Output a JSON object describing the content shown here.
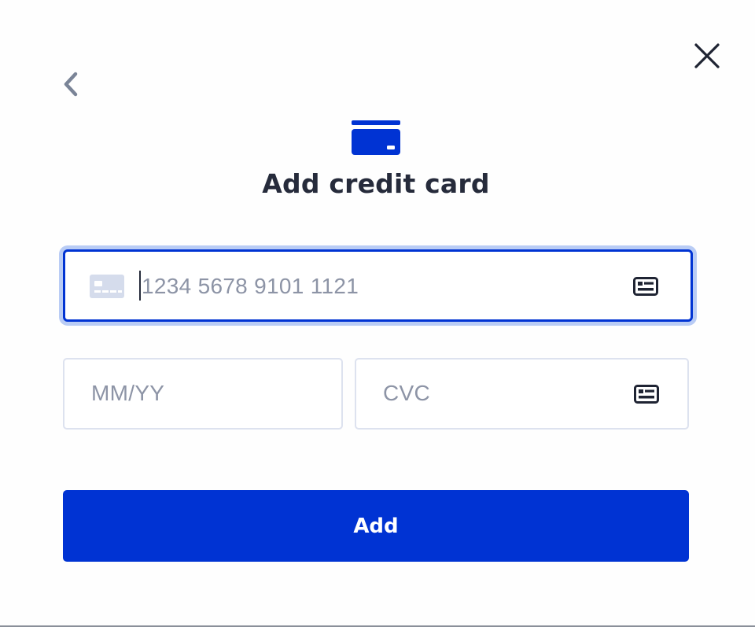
{
  "dialog": {
    "title": "Add credit card",
    "back_icon": "chevron-left-icon",
    "close_icon": "close-icon",
    "header_icon": "credit-card-icon"
  },
  "form": {
    "card_number": {
      "value": "",
      "placeholder": "1234 5678 9101 1121",
      "leading_icon": "generic-card-icon",
      "trailing_icon": "id-card-icon"
    },
    "expiry": {
      "value": "",
      "placeholder": "MM/YY"
    },
    "cvc": {
      "value": "",
      "placeholder": "CVC",
      "trailing_icon": "id-card-icon"
    }
  },
  "actions": {
    "submit_label": "Add"
  },
  "colors": {
    "accent": "#0033d3",
    "focus_ring": "#b9ccf5",
    "title_text": "#262b3b",
    "placeholder_text": "#8d94a6",
    "field_border": "#dde2ef",
    "back_icon": "#7a8497"
  }
}
